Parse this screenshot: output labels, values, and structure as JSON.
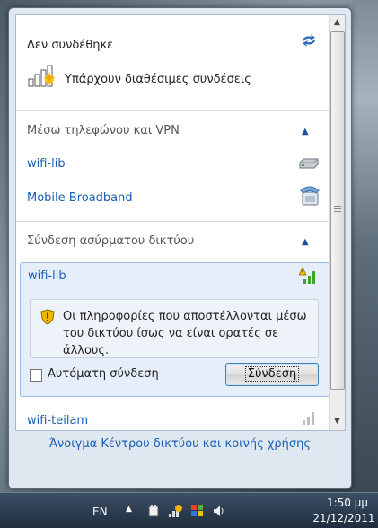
{
  "flyout": {
    "header_title": "Δεν συνδέθηκε",
    "status_text": "Υπάρχουν διαθέσιμες συνδέσεις",
    "sections": {
      "vpn_title": "Μέσω τηλεφώνου και VPN",
      "wireless_title": "Σύνδεση ασύρματου δικτύου"
    },
    "vpn_items": [
      {
        "label": "wifi-lib",
        "icon": "modem-icon"
      },
      {
        "label": "Mobile Broadband",
        "icon": "phone-icon"
      }
    ],
    "selected_network": {
      "name": "wifi-lib",
      "warning": "Οι πληροφορίες που αποστέλλονται μέσω του δικτύου ίσως να είναι ορατές σε άλλους.",
      "auto_connect_label": "Αυτόματη σύνδεση",
      "auto_connect_checked": false,
      "connect_label": "Σύνδεση"
    },
    "other_network": "wifi-teilam",
    "footer_link": "Άνοιγμα Κέντρου δικτύου και κοινής χρήσης"
  },
  "taskbar": {
    "language": "EN",
    "time": "1:50 μμ",
    "date": "21/12/2011"
  },
  "colors": {
    "link": "#1a5fb4",
    "selected_bg": "#e6eff9",
    "signal_green": "#3fa52a"
  }
}
